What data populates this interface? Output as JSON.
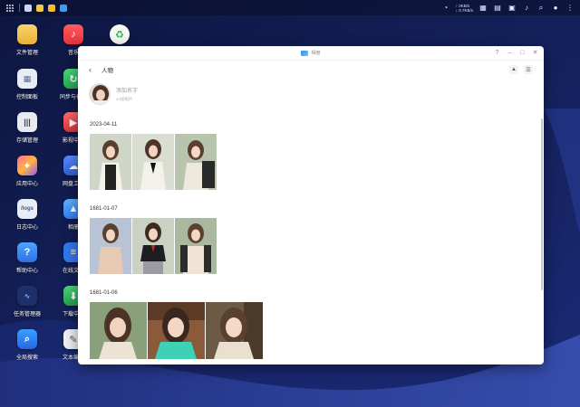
{
  "desktop": {
    "icons": [
      {
        "label": "文件管理",
        "icon": "folder-icon"
      },
      {
        "label": "控制面板",
        "icon": "control-panel-icon"
      },
      {
        "label": "存储管理",
        "icon": "storage-icon"
      },
      {
        "label": "应用中心",
        "icon": "app-center-icon"
      },
      {
        "label": "日志中心",
        "icon": "log-icon"
      },
      {
        "label": "帮助中心",
        "icon": "help-icon"
      },
      {
        "label": "任务管理器",
        "icon": "task-manager-icon"
      },
      {
        "label": "全局搜索",
        "icon": "search-icon"
      },
      {
        "label": "音乐",
        "icon": "music-icon"
      },
      {
        "label": "同步与备份",
        "icon": "sync-icon"
      },
      {
        "label": "影视中心",
        "icon": "video-icon"
      },
      {
        "label": "网盘工具",
        "icon": "cloud-drive-icon"
      },
      {
        "label": "相册",
        "icon": "photos-icon"
      },
      {
        "label": "在线文档",
        "icon": "docs-icon"
      },
      {
        "label": "下载中心",
        "icon": "download-icon"
      },
      {
        "label": "文本编辑",
        "icon": "text-editor-icon"
      }
    ]
  },
  "topbar": {
    "speed_up": "↑ 0KB/s",
    "speed_down": "↓ 0.7KB/s"
  },
  "window": {
    "app_title": "相册",
    "page_title": "人物",
    "person": {
      "name": "添加名字",
      "count": "14张照片"
    },
    "groups": [
      {
        "date": "2023-04-11",
        "photo_count": 3
      },
      {
        "date": "1681-01-07",
        "photo_count": 3
      },
      {
        "date": "1681-01-06",
        "photo_count": 3
      }
    ]
  },
  "colors": {
    "accent": "#2f8df5",
    "wallpaper_dark": "#0a1235",
    "wallpaper_wave": "#2c3d8f"
  }
}
